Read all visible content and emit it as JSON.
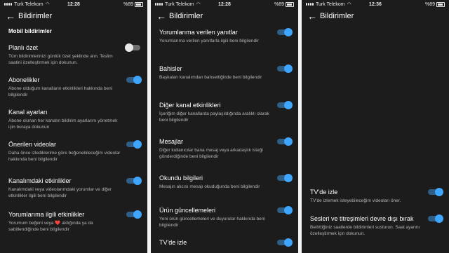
{
  "screens": [
    {
      "status": {
        "carrier": "Turk Telekom",
        "time": "12:28",
        "battery": "%89"
      },
      "title": "Bildirimler",
      "section": "Mobil bildirimler",
      "items": [
        {
          "title": "Planlı özet",
          "desc": "Tüm bildirimlerinizi günlük özet şeklinde alın. Teslim saatini özelleştirmek için dokunun.",
          "on": false
        },
        {
          "title": "Abonelikler",
          "desc": "Abone olduğum kanalların etkinlikleri hakkında beni bilgilendir",
          "on": true
        },
        {
          "title": "Kanal ayarları",
          "desc": "Abone olunan her kanalın bildirim ayarlarını yönetmek için buraya dokunun"
        },
        {
          "title": "Önerilen videolar",
          "desc": "Daha önce izlediklerime göre beğenebileceğim videolar hakkında beni bilgilendir",
          "on": true
        },
        {
          "title": "Kanalımdaki etkinlikler",
          "desc": "Kanalımdaki veya videolarımdaki yorumlar ve diğer etkinlikler ilgili beni bilgilendir",
          "on": true
        },
        {
          "title": "Yorumlarıma ilgili etkinlikler",
          "desc_a": "Yorumum beğeni veya",
          "heart": "❤️",
          "desc_b": "aldığında ya da sabitlendiğinde beni bilgilendir",
          "on": true
        }
      ]
    },
    {
      "status": {
        "carrier": "Turk Telekom",
        "time": "12:28",
        "battery": "%89"
      },
      "title": "Bildirimler",
      "items": [
        {
          "title": "Yorumlarıma verilen yanıtlar",
          "desc": "Yorumlarıma verilen yanıtlarla ilgili beni bilgilendir",
          "on": true
        },
        {
          "title": "Bahisler",
          "desc": "Başkaları kanalımdan bahsettiğinde beni bilgilendir",
          "on": true
        },
        {
          "title": "Diğer kanal etkinlikleri",
          "desc": "İçeriğim diğer kanallarda paylaşıldığında aralıklı olarak beni bilgilendir",
          "on": true
        },
        {
          "title": "Mesajlar",
          "desc": "Diğer kullanıcılar bana mesaj veya arkadaşlık isteği gönderdiğinde beni bilgilendir",
          "on": true
        },
        {
          "title": "Okundu bilgileri",
          "desc": "Mesajın alıcısı mesajı okuduğunda beni bilgilendir",
          "on": true
        },
        {
          "title": "Ürün güncellemeleri",
          "desc": "Yeni ürün güncellemeleri ve duyurular hakkında beni bilgilendir",
          "on": true
        },
        {
          "title": "TV'de izle",
          "desc": "",
          "on": true
        }
      ]
    },
    {
      "status": {
        "carrier": "Turk Telekom",
        "time": "12:36",
        "battery": "%89"
      },
      "title": "Bildirimler",
      "items": [
        {
          "title": "TV'de izle",
          "desc": "TV'de izlemek isteyebileceğim videoları öner.",
          "on": true
        },
        {
          "title": "Sesleri ve titreşimleri devre dışı bırak",
          "desc": "Belirttiğiniz saatlerde bildirimleri susturun. Saat ayarını özelleştirmek için dokunun.",
          "on": true
        }
      ]
    }
  ]
}
